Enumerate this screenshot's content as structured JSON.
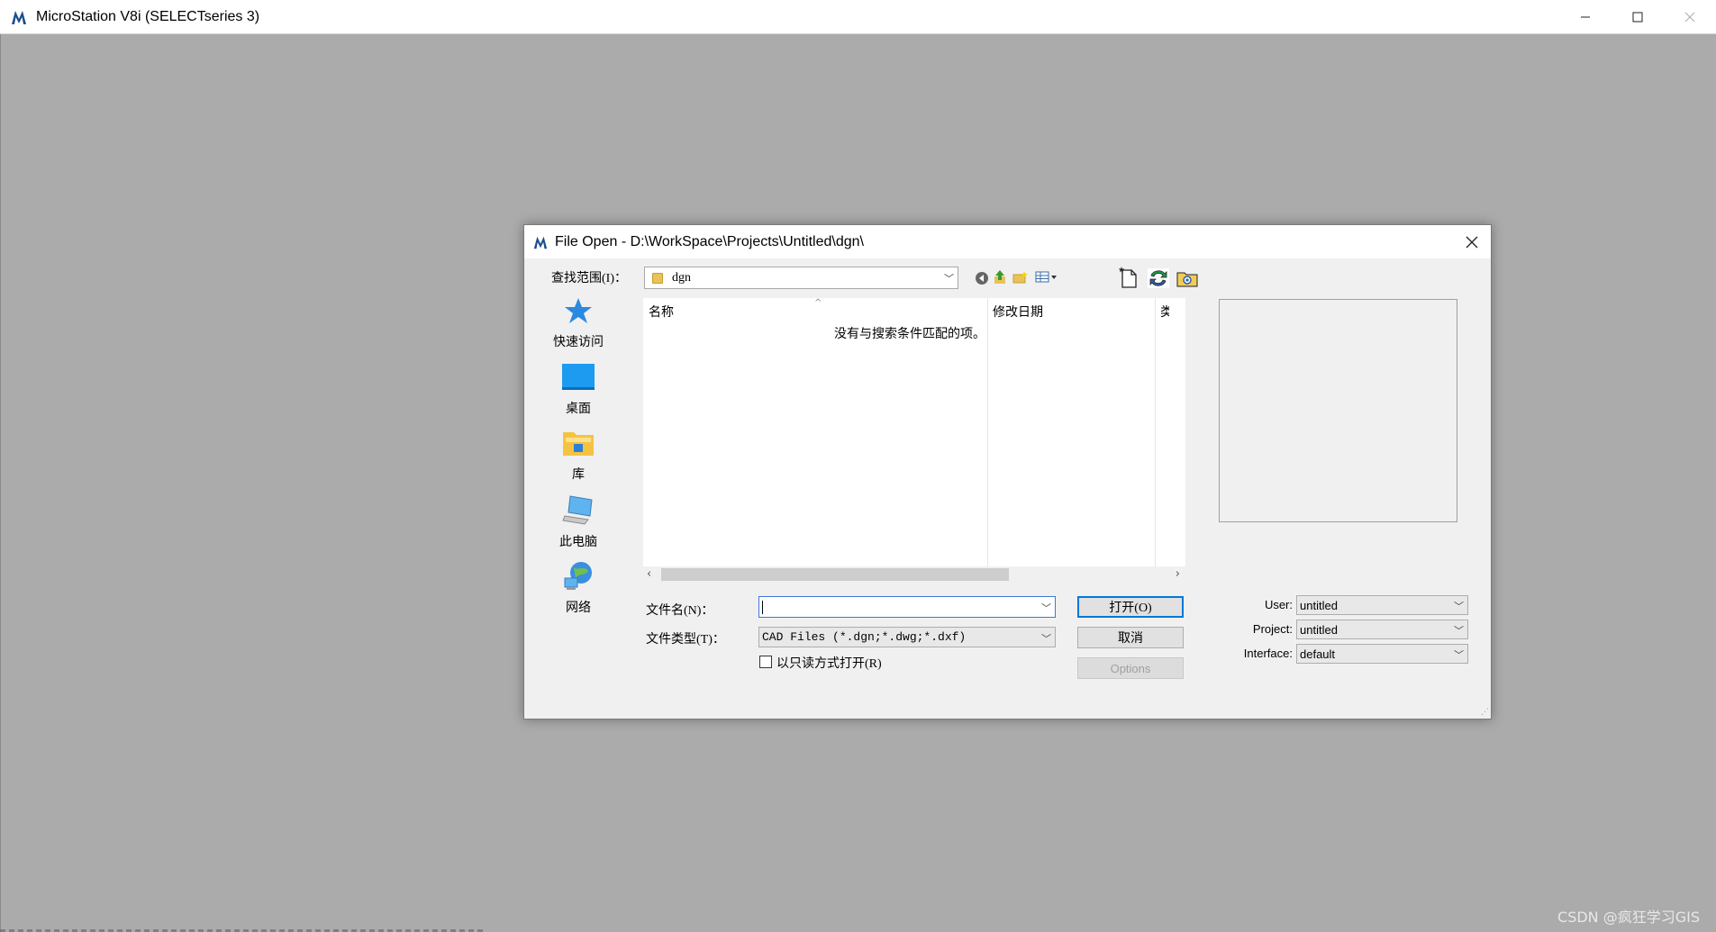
{
  "app": {
    "title": "MicroStation V8i (SELECTseries 3)"
  },
  "dialog": {
    "title": "File Open - D:\\WorkSpace\\Projects\\Untitled\\dgn\\",
    "lookin_label": "查找范围(I)：",
    "lookin_value": "dgn",
    "places": [
      {
        "label": "快速访问",
        "icon": "star-icon"
      },
      {
        "label": "桌面",
        "icon": "desktop-icon"
      },
      {
        "label": "库",
        "icon": "library-folder-icon"
      },
      {
        "label": "此电脑",
        "icon": "computer-icon"
      },
      {
        "label": "网络",
        "icon": "network-icon"
      }
    ],
    "columns": {
      "name": "名称",
      "date": "修改日期",
      "type": "类"
    },
    "empty_message": "没有与搜索条件匹配的项。",
    "filename_label": "文件名(N)：",
    "filename_value": "",
    "filetype_label": "文件类型(T)：",
    "filetype_value": "CAD Files (*.dgn;*.dwg;*.dxf)",
    "readonly_label": "以只读方式打开(R)",
    "buttons": {
      "open": "打开(O)",
      "cancel": "取消",
      "options": "Options"
    },
    "user_label": "User:",
    "user_value": "untitled",
    "project_label": "Project:",
    "project_value": "untitled",
    "interface_label": "Interface:",
    "interface_value": "default"
  },
  "watermark": "CSDN @疯狂学习GIS",
  "colors": {
    "accent": "#0078d7",
    "workspace": "#ababab"
  }
}
